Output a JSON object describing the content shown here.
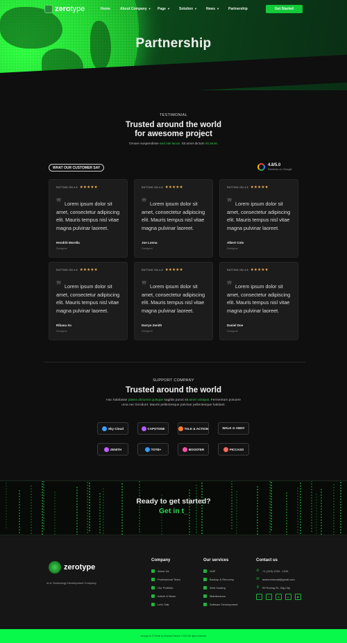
{
  "header": {
    "brand": {
      "bold": "zero",
      "light": "type"
    },
    "nav": [
      {
        "label": "Home",
        "has_dropdown": false
      },
      {
        "label": "About Company",
        "has_dropdown": true
      },
      {
        "label": "Page",
        "has_dropdown": true
      },
      {
        "label": "Solution",
        "has_dropdown": true
      },
      {
        "label": "News",
        "has_dropdown": true
      },
      {
        "label": "Partnership",
        "has_dropdown": false
      }
    ],
    "cta_label": "Get Started",
    "page_title": "Partnership"
  },
  "testimonial": {
    "eyebrow": "TESTIMONIAL",
    "title_line1": "Trusted around the world",
    "title_line2": "for awesome project",
    "subtitle_parts": [
      {
        "text": "Ornare suspendisse ",
        "highlight": false
      },
      {
        "text": "sed nisi lacus",
        "highlight": true
      },
      {
        "text": ". Sit amet dictum ",
        "highlight": false
      },
      {
        "text": "sit amet",
        "highlight": true
      },
      {
        "text": ".",
        "highlight": false
      }
    ],
    "pill_label": "WHAT OUR CUSTOMER SAY",
    "google": {
      "icon": "google-icon",
      "score": "4.8/5.0",
      "source": "Reviews on Google"
    },
    "cards": [
      {
        "rating_label": "RATTING ON 4.8",
        "stars": "★★★★★",
        "quote": "Lorem ipsum dolor sit amet, consectetur adipiscing elit. Mauris tempus nisl vitae magna pulvinar laoreet.",
        "author": "Hendrik Morella",
        "role": "Designer"
      },
      {
        "rating_label": "RATTING ON 4.8",
        "stars": "★★★★★",
        "quote": "Lorem ipsum dolor sit amet, consectetur adipiscing elit. Mauris tempus nisl vitae magna pulvinar laoreet.",
        "author": "Joe Lonna",
        "role": "Designer"
      },
      {
        "rating_label": "RATTING ON 4.8",
        "stars": "★★★★★",
        "quote": "Lorem ipsum dolor sit amet, consectetur adipiscing elit. Mauris tempus nisl vitae magna pulvinar laoreet.",
        "author": "Albert Colo",
        "role": "Designer"
      },
      {
        "rating_label": "RATTING ON 4.8",
        "stars": "★★★★★",
        "quote": "Lorem ipsum dolor sit amet, consectetur adipiscing elit. Mauris tempus nisl vitae magna pulvinar laoreet.",
        "author": "Rihana Xo",
        "role": "Designer"
      },
      {
        "rating_label": "RATTING ON 4.8",
        "stars": "★★★★★",
        "quote": "Lorem ipsum dolor sit amet, consectetur adipiscing elit. Mauris tempus nisl vitae magna pulvinar laoreet.",
        "author": "Darryn Zenith",
        "role": "Designer"
      },
      {
        "rating_label": "RATTING ON 4.8",
        "stars": "★★★★★",
        "quote": "Lorem ipsum dolor sit amet, consectetur adipiscing elit. Mauris tempus nisl vitae magna pulvinar laoreet.",
        "author": "Daniel Doe",
        "role": "Designer"
      }
    ]
  },
  "support": {
    "eyebrow": "SUPPORT COMPANY",
    "title": "Trusted around the world",
    "subtitle_parts": [
      {
        "text": "Hac habitasse ",
        "highlight": false
      },
      {
        "text": "platea dictumst quisque",
        "highlight": true
      },
      {
        "text": " sagittis purus sit ",
        "highlight": false
      },
      {
        "text": "amet volutpat",
        "highlight": true
      },
      {
        "text": ". Fermentum posuere urna nec tincidunt. Mauris pellentesque pulvinar pellentesque habitant.",
        "highlight": false
      }
    ],
    "partners": [
      {
        "name": "Sky Cloud",
        "color": "#3aa0ff"
      },
      {
        "name": "CAPSTONE",
        "color": "#b25cff"
      },
      {
        "name": "TALK & ACTION",
        "color": "#ff7a2f"
      },
      {
        "name": "WALK ⊙ AWAY",
        "color": ""
      },
      {
        "name": "ZENITH",
        "color": "#c45cff"
      },
      {
        "name": "TOTB+",
        "color": "#2f9dff"
      },
      {
        "name": "BOOSTER",
        "color": "#ff4fa8"
      },
      {
        "name": "PICCASO",
        "color": "#ff6a5c"
      }
    ]
  },
  "cta": {
    "title": "Ready to get started?",
    "link_text": "Get in t_"
  },
  "footer": {
    "brand": "zerotype",
    "tagline": "AI & Technology Development Company",
    "columns": [
      {
        "title": "Company",
        "links": [
          "About Us",
          "Professional Team",
          "Our Portfolio",
          "Article & News",
          "Let's Talk"
        ]
      },
      {
        "title": "Our services",
        "links": [
          "VoIP",
          "Backup & Recovery",
          "Web Hosting",
          "Maintenance",
          "Software Development"
        ]
      }
    ],
    "contact": {
      "title": "Contact us",
      "items": [
        {
          "icon": "phone-icon",
          "glyph": "✆",
          "text": "+1 (123) 1234 - 1234"
        },
        {
          "icon": "mail-icon",
          "glyph": "✉",
          "text": "awesomemail@gmail.com"
        },
        {
          "icon": "location-icon",
          "glyph": "⚲",
          "text": "99 Roving St., Big City"
        }
      ],
      "socials": [
        {
          "name": "facebook-icon",
          "glyph": "f"
        },
        {
          "name": "twitter-icon",
          "glyph": "t"
        },
        {
          "name": "instagram-icon",
          "glyph": "◎"
        },
        {
          "name": "pinterest-icon",
          "glyph": "p"
        },
        {
          "name": "youtube-icon",
          "glyph": "▶"
        }
      ]
    },
    "copyright": "zerotype ai IT theme by ShadowThemes © 2023 All rights reserved."
  },
  "colors": {
    "accent": "#14c93a",
    "highlight": "#36c94f",
    "bottom_bar": "#08f94a",
    "star": "#f3b451"
  }
}
